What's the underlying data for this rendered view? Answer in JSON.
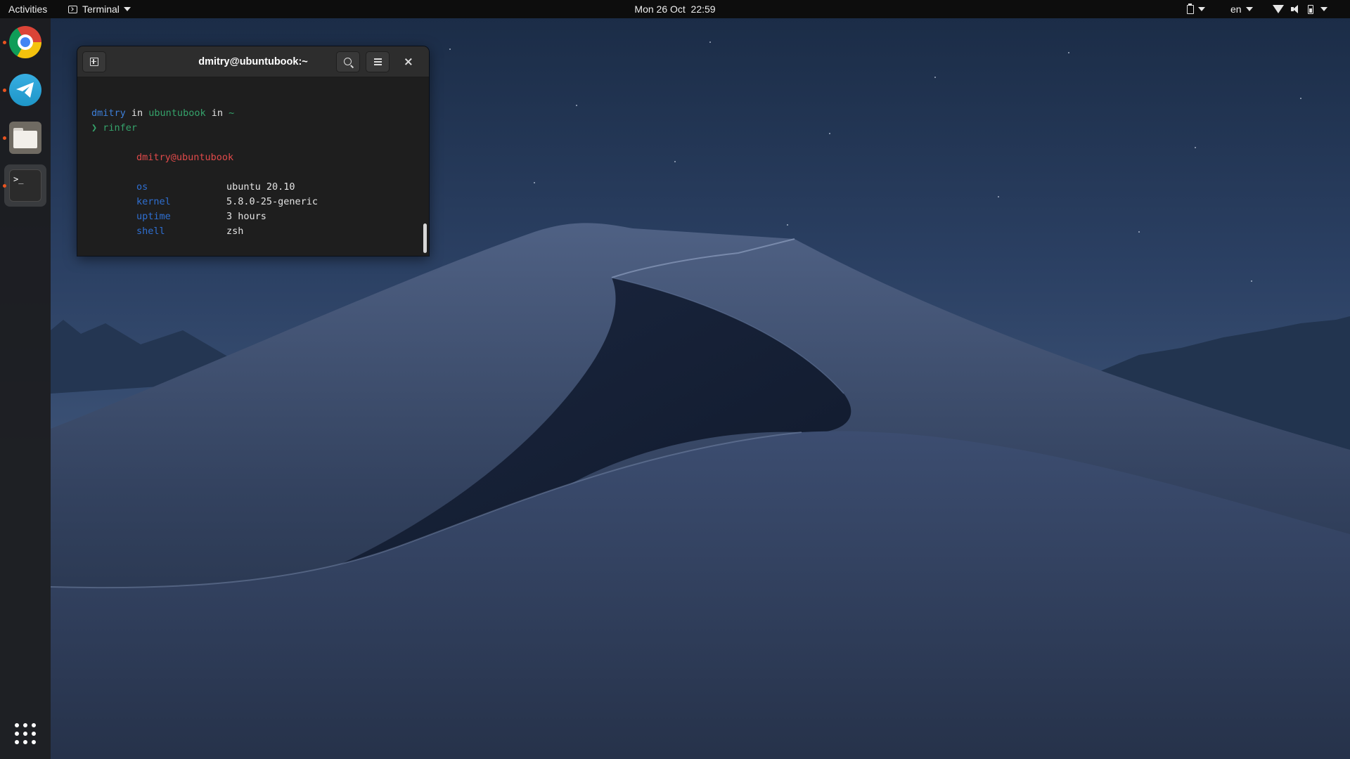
{
  "topbar": {
    "activities": "Activities",
    "app_menu": "Terminal",
    "clock": "Mon 26 Oct  22:59",
    "language": "en",
    "icons": [
      "terminal-icon",
      "clipboard-icon",
      "wifi-icon",
      "volume-icon",
      "battery-icon"
    ]
  },
  "dock": {
    "apps": [
      {
        "name": "Google Chrome",
        "icon": "chrome-icon",
        "running": true
      },
      {
        "name": "Telegram",
        "icon": "telegram-icon",
        "running": true
      },
      {
        "name": "Files",
        "icon": "files-icon",
        "running": true
      },
      {
        "name": "Terminal",
        "icon": "terminal-icon",
        "running": true,
        "active": true
      }
    ],
    "terminal_glyph": ">_",
    "show_apps_icon": "app-grid-icon"
  },
  "terminal": {
    "title": "dmitry@ubuntubook:~",
    "prompt": {
      "user": "dmitry",
      "in1": " in ",
      "host": "ubuntubook",
      "in2": " in ",
      "dir": "~"
    },
    "command": {
      "symbol": "❯",
      "text": " rinfer"
    },
    "output": {
      "userhost": "dmitry@ubuntubook",
      "rows": [
        {
          "key": "os",
          "value": "ubuntu 20.10"
        },
        {
          "key": "kernel",
          "value": "5.8.0-25-generic"
        },
        {
          "key": "uptime",
          "value": "3 hours"
        },
        {
          "key": "shell",
          "value": "zsh"
        }
      ]
    }
  },
  "colors": {
    "accent_running_dot": "#e95420",
    "prompt_user": "#3d7fd9",
    "prompt_host": "#35a36b",
    "output_userhost": "#e04a4a",
    "output_keys": "#2f6fd1"
  }
}
